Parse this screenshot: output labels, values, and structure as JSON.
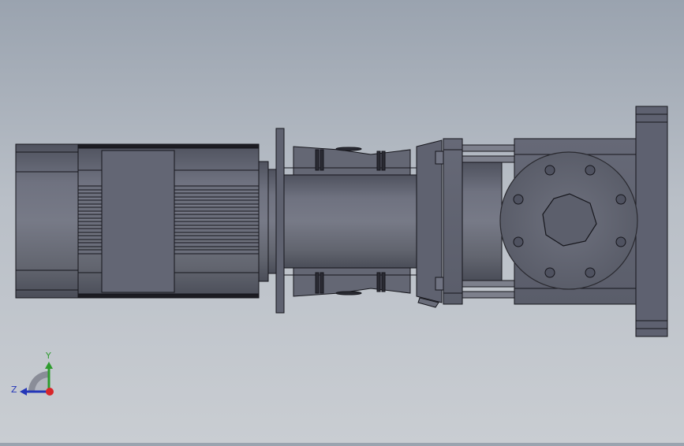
{
  "viewport": {
    "background_top": "#9aa3af",
    "background_bottom": "#c9cdd2",
    "model_colors": {
      "body_dark": "#5b5e6b",
      "body_mid": "#6c6f7c",
      "body_light": "#8a8d98",
      "edge": "#16161c"
    }
  },
  "triad": {
    "y_label": "Y",
    "z_label": "Z",
    "x_color": "#d8262a",
    "y_color": "#2e9b2e",
    "z_color": "#2436b8"
  }
}
